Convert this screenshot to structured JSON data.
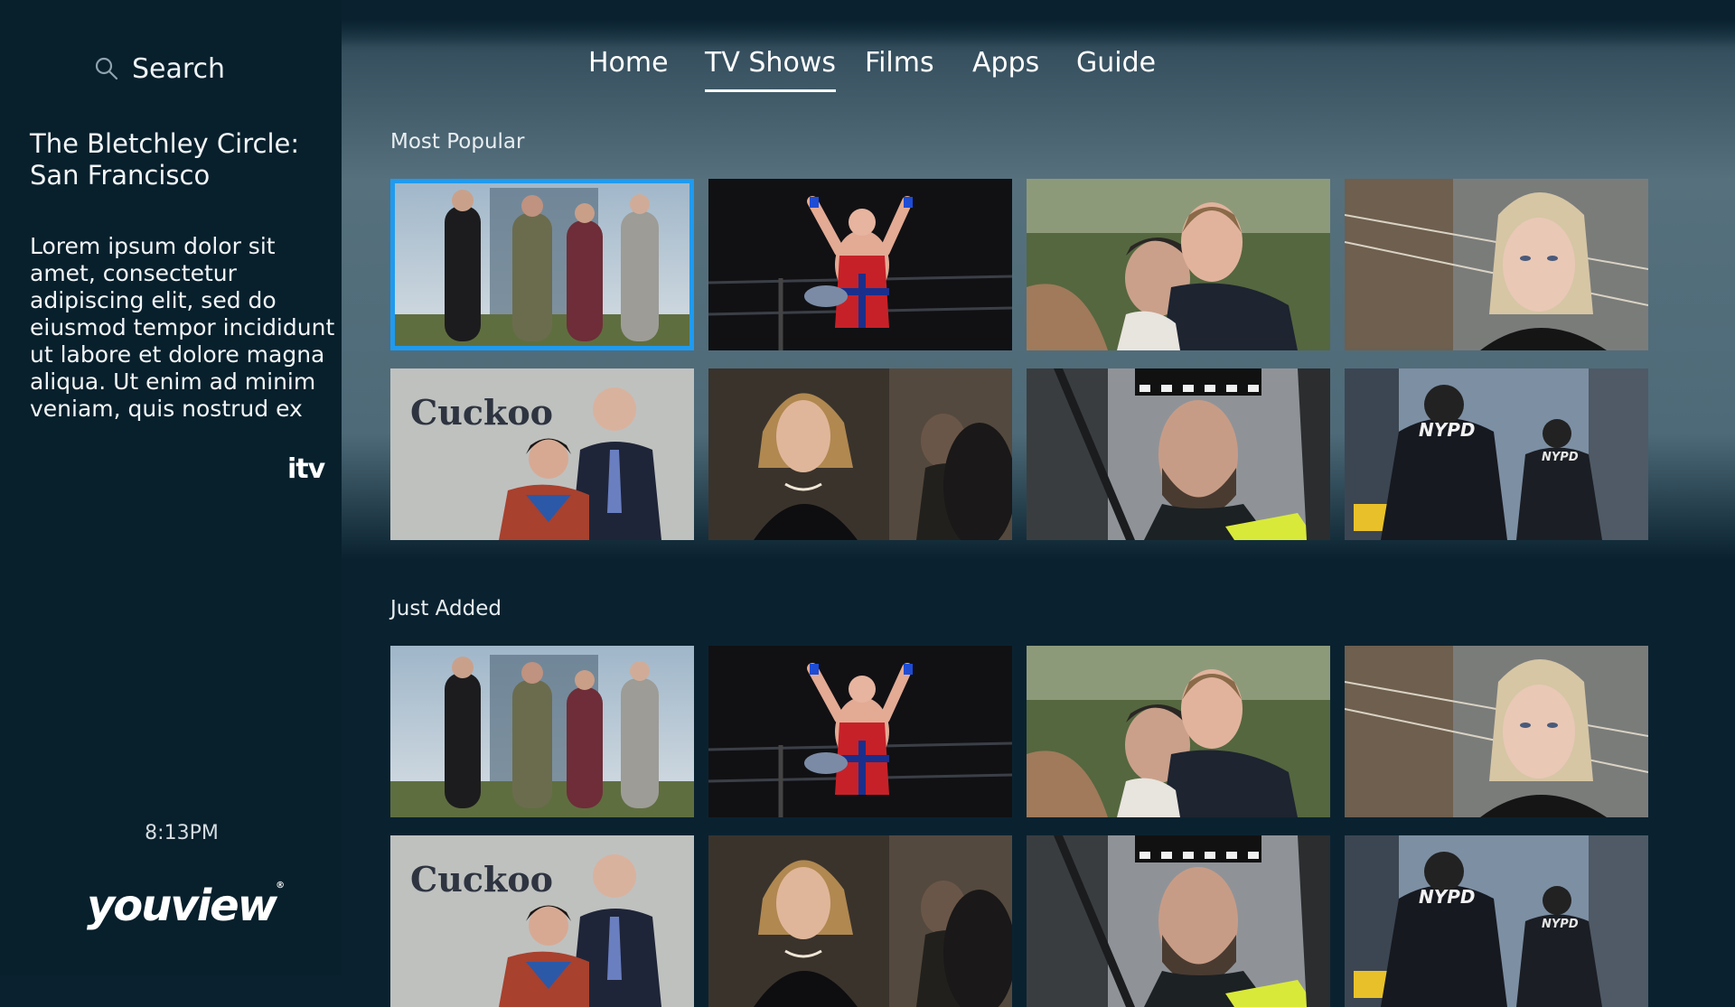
{
  "sidebar": {
    "search_label": "Search",
    "show_title": "The Bletchley Circle: San Francisco",
    "show_description": "Lorem ipsum dolor sit amet, consectetur adipiscing elit, sed do eiusmod tempor incididunt ut labore et dolore magna aliqua. Ut enim ad minim veniam, quis nostrud ex",
    "channel_logo": "itv",
    "clock": "8:13PM",
    "brand": "youview",
    "brand_mark": "®"
  },
  "nav": {
    "items": [
      "Home",
      "TV Shows",
      "Films",
      "Apps",
      "Guide"
    ],
    "active": "TV Shows"
  },
  "sections": [
    {
      "title": "Most Popular",
      "rows": [
        [
          "The Bletchley Circle",
          "Wrestler",
          "Hugging Couple",
          "Blonde Woman"
        ],
        [
          "Cuckoo",
          "Woman in Black Dress",
          "Police Officer",
          "NYPD"
        ]
      ]
    },
    {
      "title": "Just Added",
      "rows": [
        [
          "The Bletchley Circle",
          "Wrestler",
          "Hugging Couple",
          "Blonde Woman"
        ],
        [
          "Cuckoo",
          "Woman in Black Dress",
          "Police Officer",
          "NYPD"
        ]
      ]
    }
  ],
  "tile_text": {
    "cuckoo": "Cuckoo",
    "nypd": "NYPD"
  },
  "colors": {
    "focus": "#1e9bf0",
    "sidebar_bg": "#08202c",
    "page_bg": "#0a2230"
  }
}
